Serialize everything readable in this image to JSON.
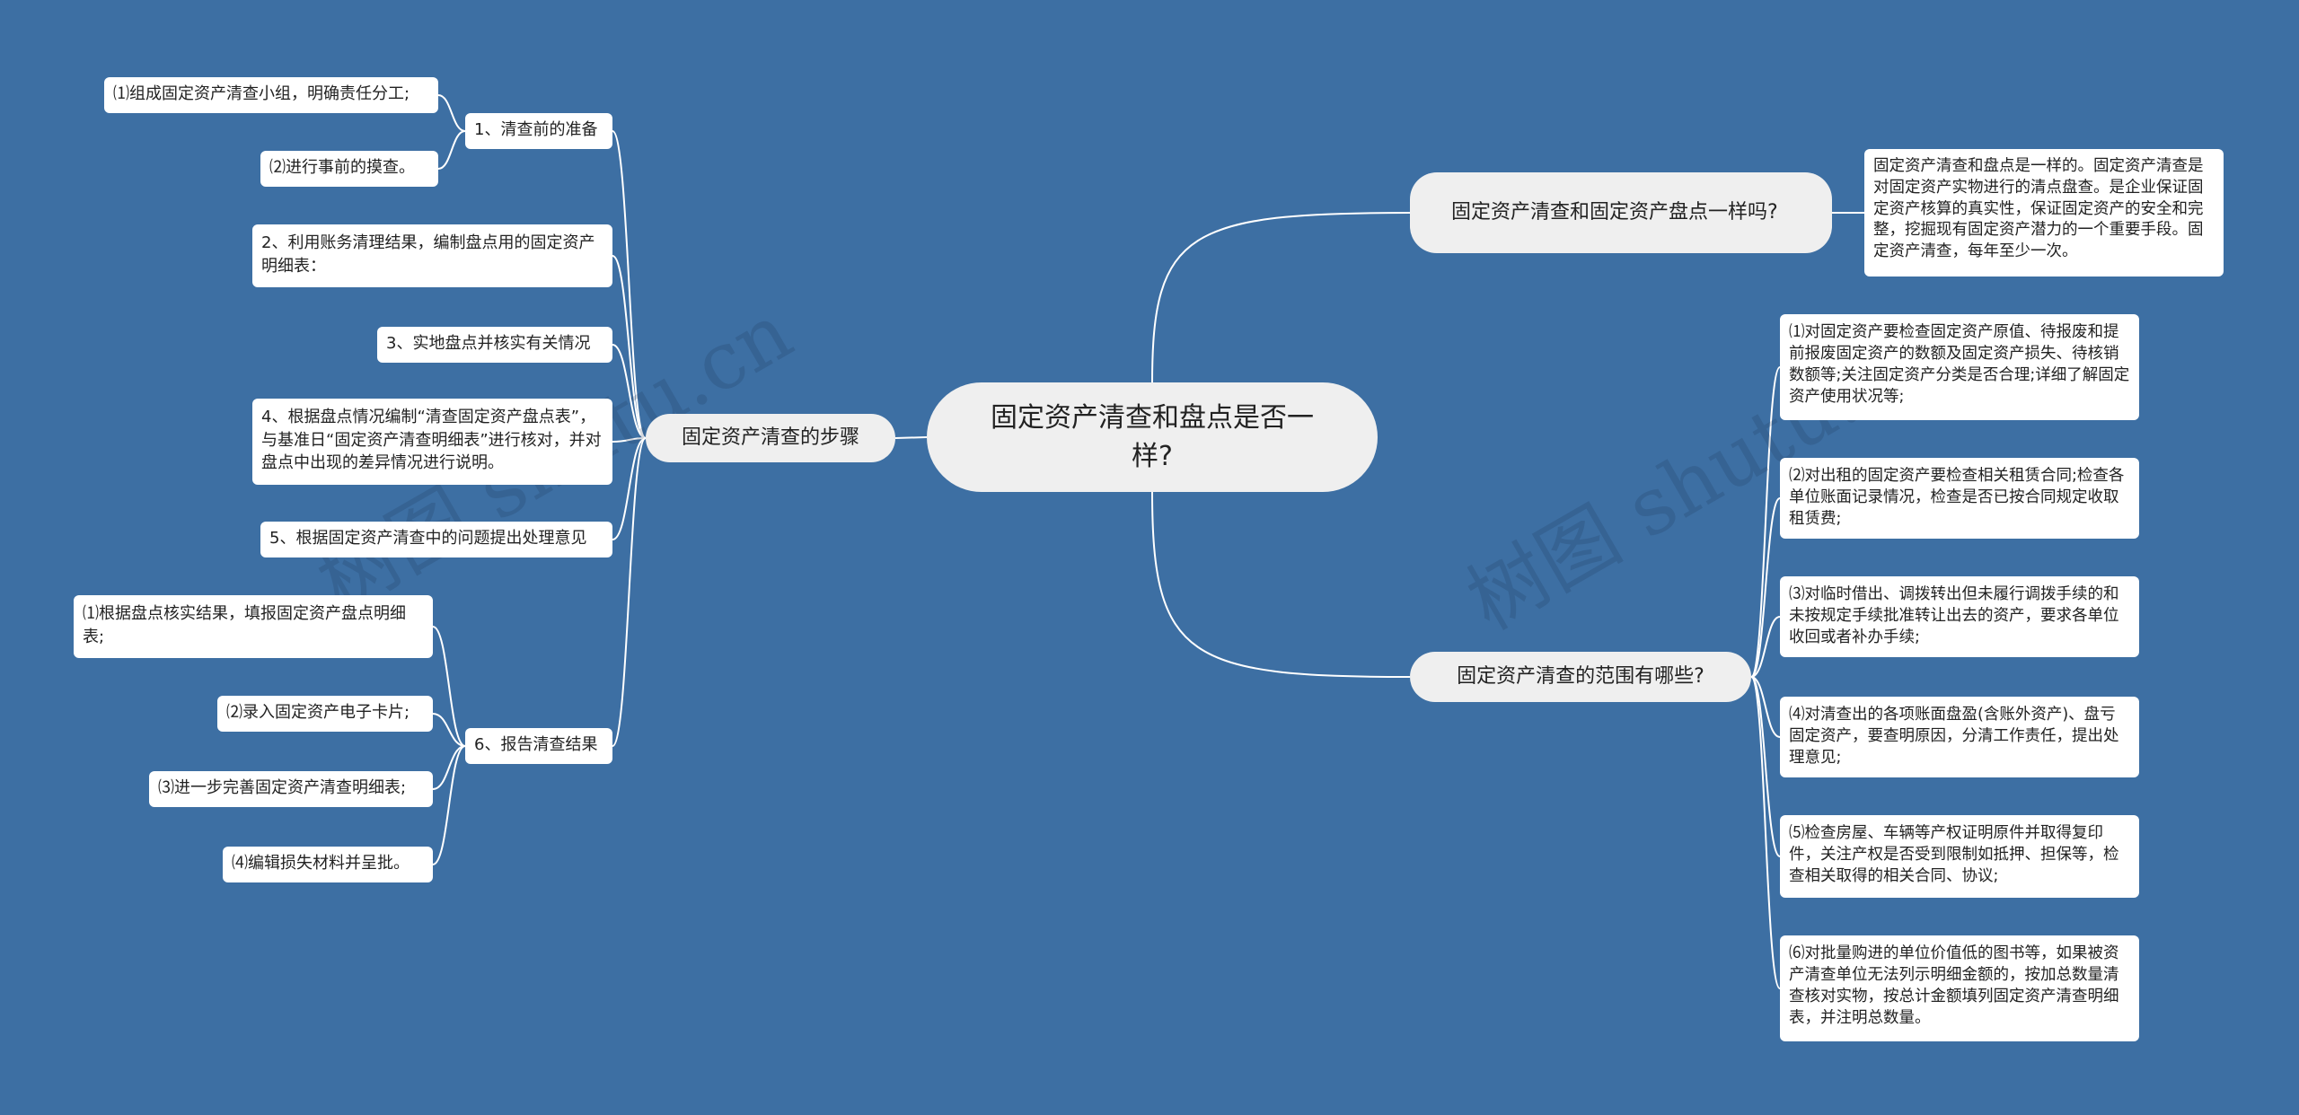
{
  "root": "固定资产清查和盘点是否一样?",
  "watermark": "树图 shutu.cn",
  "left_branch": {
    "label": "固定资产清查的步骤",
    "steps": [
      {
        "label": "1、清查前的准备",
        "children": [
          "⑴组成固定资产清查小组，明确责任分工;",
          "⑵进行事前的摸查。"
        ]
      },
      {
        "label": "2、利用账务清理结果，编制盘点用的固定资产明细表："
      },
      {
        "label": "3、实地盘点并核实有关情况"
      },
      {
        "label": "4、根据盘点情况编制“清查固定资产盘点表”，与基准日“固定资产清查明细表”进行核对，并对盘点中出现的差异情况进行说明。"
      },
      {
        "label": "5、根据固定资产清查中的问题提出处理意见"
      },
      {
        "label": "6、报告清查结果",
        "children": [
          "⑴根据盘点核实结果，填报固定资产盘点明细表;",
          "⑵录入固定资产电子卡片;",
          "⑶进一步完善固定资产清查明细表;",
          "⑷编辑损失材料并呈批。"
        ]
      }
    ]
  },
  "right_branches": [
    {
      "label": "固定资产清查和固定资产盘点一样吗?",
      "children": [
        "固定资产清查和盘点是一样的。固定资产清查是对固定资产实物进行的清点盘查。是企业保证固定资产核算的真实性，保证固定资产的安全和完整，挖掘现有固定资产潜力的一个重要手段。固定资产清查，每年至少一次。"
      ]
    },
    {
      "label": "固定资产清查的范围有哪些?",
      "children": [
        "⑴对固定资产要检查固定资产原值、待报废和提前报废固定资产的数额及固定资产损失、待核销数额等;关注固定资产分类是否合理;详细了解固定资产使用状况等;",
        "⑵对出租的固定资产要检查相关租赁合同;检查各单位账面记录情况，检查是否已按合同规定收取租赁费;",
        "⑶对临时借出、调拨转出但未履行调拨手续的和未按规定手续批准转让出去的资产，要求各单位收回或者补办手续;",
        "⑷对清查出的各项账面盘盈(含账外资产)、盘亏固定资产，要查明原因，分清工作责任，提出处理意见;",
        "⑸检查房屋、车辆等产权证明原件并取得复印件，关注产权是否受到限制如抵押、担保等，检查相关取得的相关合同、协议;",
        "⑹对批量购进的单位价值低的图书等，如果被资产清查单位无法列示明细金额的，按加总数量清查核对实物，按总计金额填列固定资产清查明细表，并注明总数量。"
      ]
    }
  ],
  "colors": {
    "background": "#3d6fa3",
    "line": "#ffffff",
    "node": "#ffffff",
    "pill": "#efefef"
  }
}
